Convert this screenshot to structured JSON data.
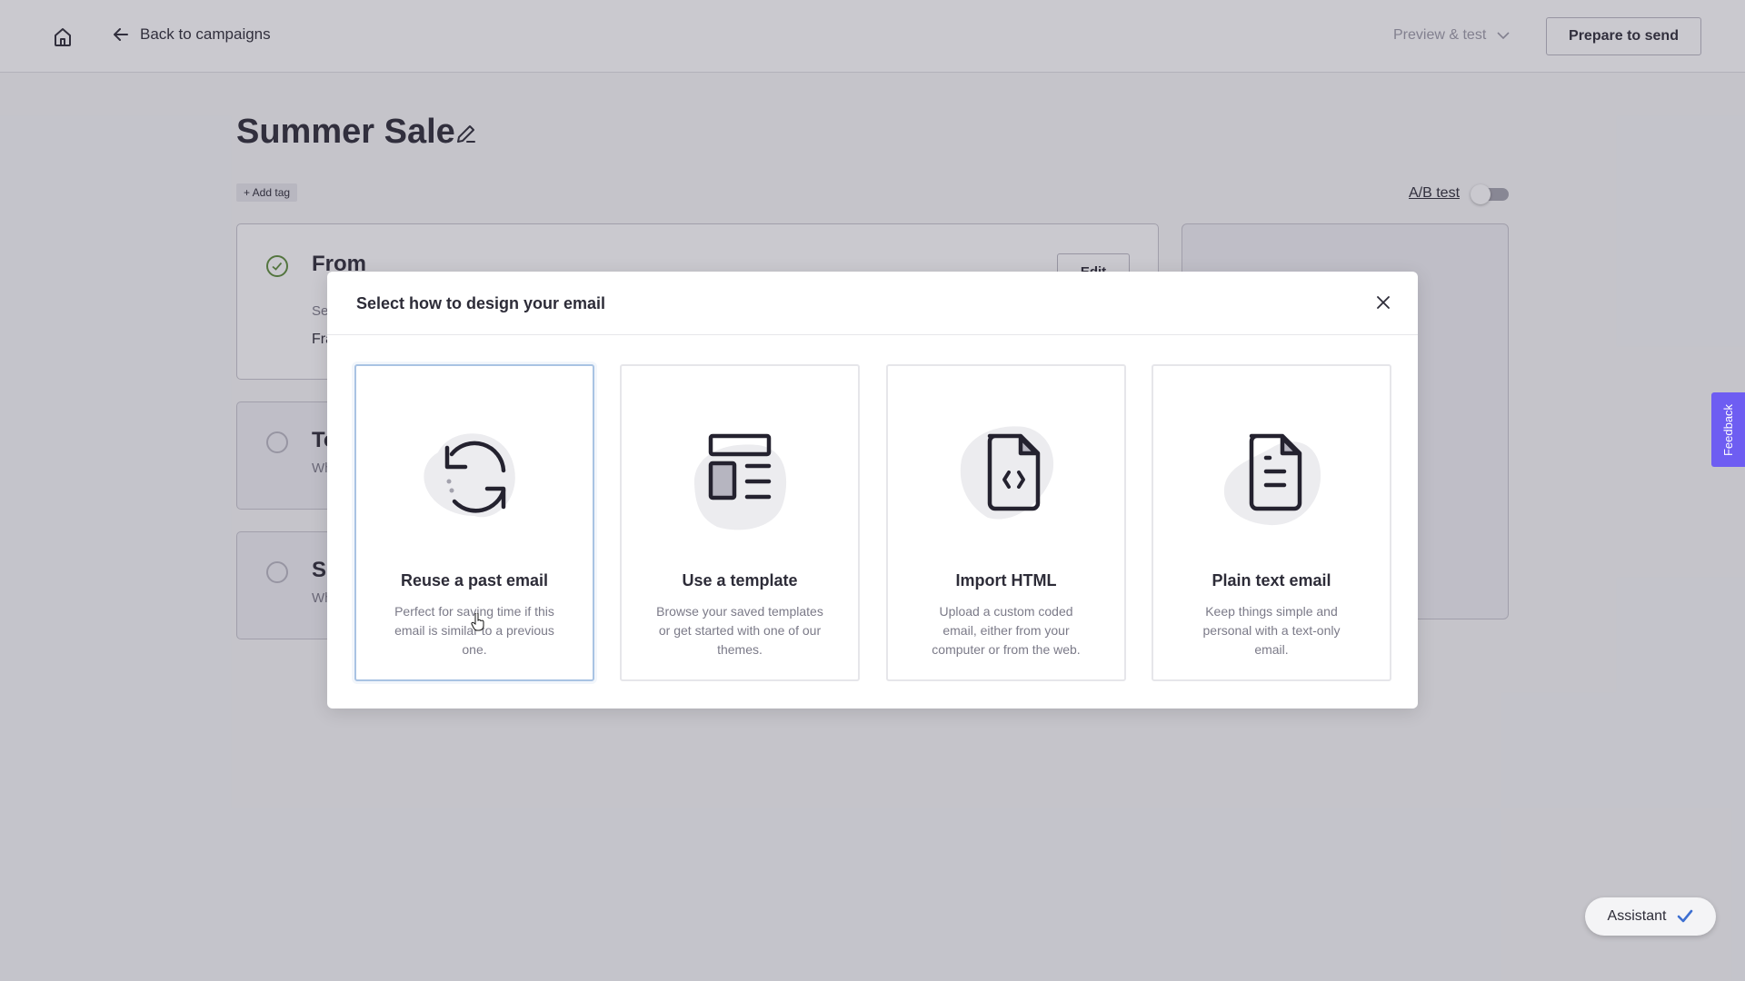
{
  "topbar": {
    "home_icon": "home-icon",
    "back_label": "Back to campaigns",
    "preview_label": "Preview & test",
    "prepare_label": "Prepare to send"
  },
  "campaign": {
    "title": "Summer Sale",
    "add_tag_label": "+ Add tag",
    "ab_test_label": "A/B test",
    "ab_test_enabled": false
  },
  "sections": {
    "from": {
      "title": "From",
      "subtitle": "Se",
      "value": "Fra",
      "edit_label": "Edit",
      "status": "complete"
    },
    "to": {
      "title": "To",
      "subtitle": "Wh",
      "status": "incomplete"
    },
    "subject": {
      "title": "S",
      "subtitle": "Wh",
      "status": "incomplete"
    }
  },
  "modal": {
    "title": "Select how to design your email",
    "close_icon": "close-icon",
    "options": [
      {
        "title": "Reuse a past email",
        "description": "Perfect for saving time if this email is similar to a previous one.",
        "icon": "refresh-icon",
        "selected": true
      },
      {
        "title": "Use a template",
        "description": "Browse your saved templates or get started with one of our themes.",
        "icon": "template-layout-icon",
        "selected": false
      },
      {
        "title": "Import HTML",
        "description": "Upload a custom coded email, either from your computer or from the web.",
        "icon": "code-file-icon",
        "selected": false
      },
      {
        "title": "Plain text email",
        "description": "Keep things simple and personal with a text-only email.",
        "icon": "text-file-icon",
        "selected": false
      }
    ]
  },
  "feedback_label": "Feedback",
  "assistant_label": "Assistant",
  "colors": {
    "accent": "#6e5df2",
    "selected_border": "#a9c3e3",
    "success": "#5b8a3a",
    "assistant_check": "#3d6fd1"
  }
}
